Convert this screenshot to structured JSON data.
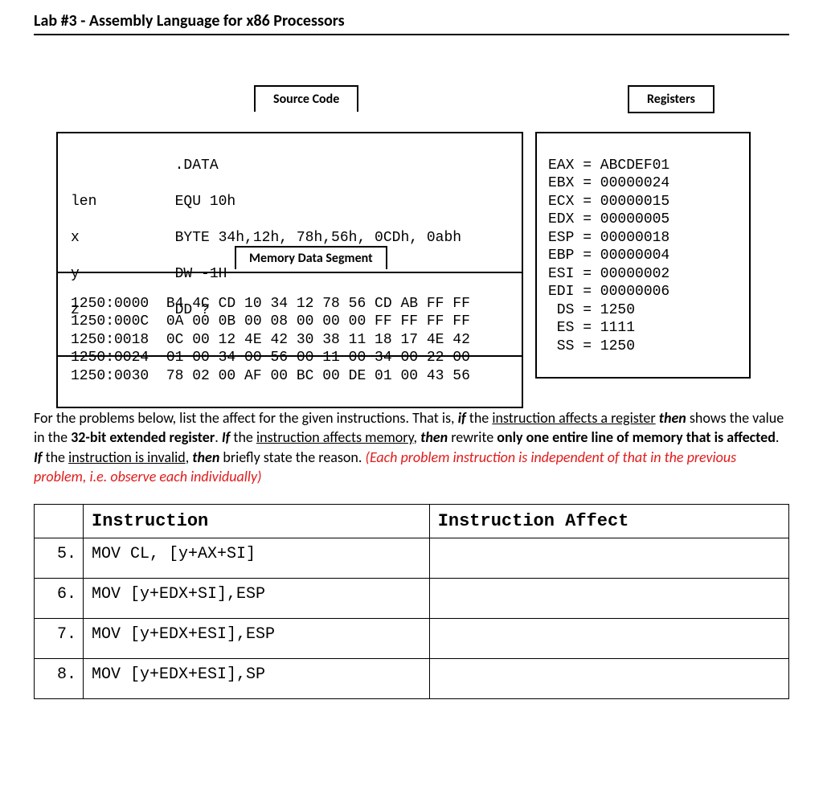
{
  "title": "Lab #3 - Assembly Language for x86 Processors",
  "tabs": {
    "source": "Source Code",
    "registers": "Registers",
    "memory": "Memory Data Segment"
  },
  "source": {
    "l1": "            .DATA",
    "l2": "len         EQU 10h",
    "l3": "x           BYTE 34h,12h, 78h,56h, 0CDh, 0abh",
    "l4": "y           DW -1H",
    "l5": "z           DD ?"
  },
  "memory": {
    "l1": "1250:0000  B4 4C CD 10 34 12 78 56 CD AB FF FF",
    "l2": "1250:000C  0A 00 0B 00 08 00 00 00 FF FF FF FF",
    "l3": "1250:0018  0C 00 12 4E 42 30 38 11 18 17 4E 42",
    "l4": "1250:0024  01 00 34 00 56 00 11 00 34 00 22 00",
    "l5": "1250:0030  78 02 00 AF 00 BC 00 DE 01 00 43 56"
  },
  "registers": {
    "l1": "EAX = ABCDEF01",
    "l2": "EBX = 00000024",
    "l3": "ECX = 00000015",
    "l4": "EDX = 00000005",
    "l5": "ESP = 00000018",
    "l6": "EBP = 00000004",
    "l7": "ESI = 00000002",
    "l8": "EDI = 00000006",
    "l9": " DS = 1250",
    "l10": " ES = 1111",
    "l11": " SS = 1250"
  },
  "instr_text": {
    "p1a": "For the problems below, list the affect for the given instructions. That is, ",
    "p1b": "if",
    "p1c": " the ",
    "p1d": "instruction affects a register",
    "p1e": " ",
    "p1f": "then",
    "p1g": " shows the value in the ",
    "p1h": "32-bit extended register",
    "p1i": ". ",
    "p1j": "If",
    "p1k": " the ",
    "p1l": "instruction affects memory",
    "p1m": ", ",
    "p1n": "then",
    "p1o": " rewrite ",
    "p1p": "only one entire line of memory that is affected",
    "p1q": ". ",
    "p1r": "If",
    "p1s": " the ",
    "p1t": "instruction is invalid",
    "p1u": ", ",
    "p1v": "then",
    "p1w": " briefly state the reason. ",
    "p1x": "(Each problem instruction is independent of that in the previous problem, i.e. observe each individually)"
  },
  "table": {
    "header_instruction": "Instruction",
    "header_affect": "Instruction Affect",
    "rows": [
      {
        "num": "5.",
        "instr": "MOV CL, [y+AX+SI]",
        "affect": ""
      },
      {
        "num": "6.",
        "instr": "MOV [y+EDX+SI],ESP",
        "affect": ""
      },
      {
        "num": "7.",
        "instr": "MOV [y+EDX+ESI],ESP",
        "affect": ""
      },
      {
        "num": "8.",
        "instr": "MOV [y+EDX+ESI],SP",
        "affect": ""
      }
    ]
  }
}
